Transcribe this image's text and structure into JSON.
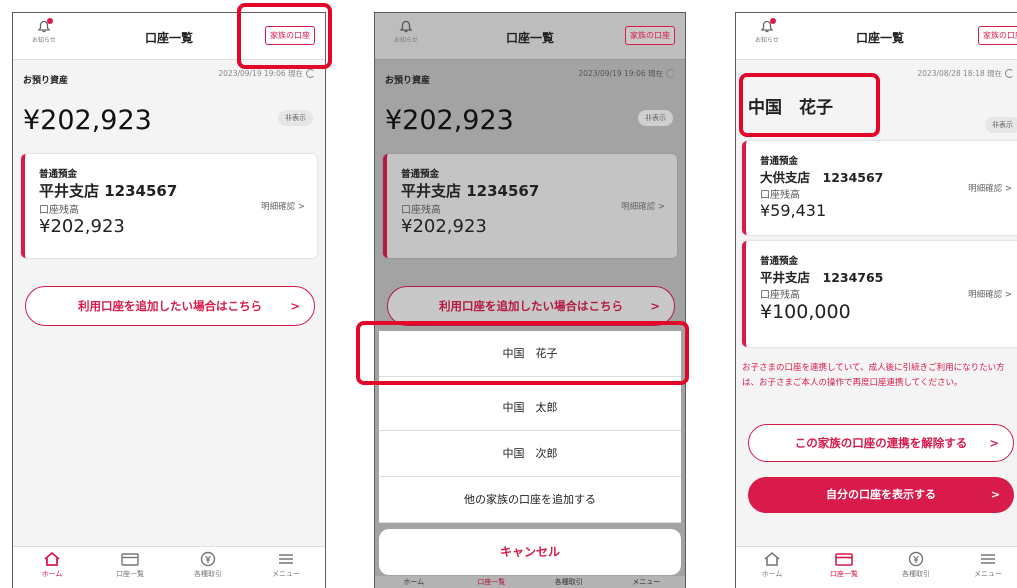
{
  "common": {
    "notification_label": "お知らせ",
    "title": "口座一覧",
    "family_button": "家族の口座",
    "details_link": "明細確認 >",
    "balance_label": "口座残高",
    "account_type": "普通預金",
    "hide_button": "非表示",
    "assets_label": "お預り資産"
  },
  "screen1": {
    "as_of": "2023/09/19 19:06 現在",
    "total": "¥202,923",
    "account": {
      "branch": "平井支店 1234567",
      "balance": "¥202,923"
    },
    "add_account_button": "利用口座を追加したい場合はこちら",
    "tabs": [
      {
        "label": "ホーム",
        "icon": "home-icon",
        "active": true
      },
      {
        "label": "口座一覧",
        "icon": "card-icon",
        "active": false
      },
      {
        "label": "各種取引",
        "icon": "yen-icon",
        "active": false
      },
      {
        "label": "メニュー",
        "icon": "menu-icon",
        "active": false
      }
    ]
  },
  "screen2": {
    "as_of": "2023/09/19 19:06 現在",
    "total": "¥202,923",
    "account": {
      "branch": "平井支店 1234567",
      "balance": "¥202,923"
    },
    "add_account_button": "利用口座を追加したい場合はこちら",
    "sheet_items": [
      "中国　花子",
      "中国　太郎",
      "中国　次郎",
      "他の家族の口座を追加する"
    ],
    "cancel": "キャンセル",
    "tabs": [
      "ホーム",
      "口座一覧",
      "各種取引",
      "メニュー"
    ]
  },
  "screen3": {
    "as_of": "2023/08/28 18:18 現在",
    "owner": "中国　花子",
    "accounts": [
      {
        "branch": "大供支店　1234567",
        "balance": "¥59,431"
      },
      {
        "branch": "平井支店　1234765",
        "balance": "¥100,000"
      }
    ],
    "notice": "お子さまの口座を連携していて、成人後に引続きご利用になりたい方は、お子さまご本人の操作で再度口座連携してください。",
    "unlink_button": "この家族の口座の連携を解除する",
    "own_accounts_button": "自分の口座を表示する",
    "tabs": [
      {
        "label": "ホーム",
        "icon": "home-icon",
        "active": false
      },
      {
        "label": "口座一覧",
        "icon": "card-icon",
        "active": true
      },
      {
        "label": "各種取引",
        "icon": "yen-icon",
        "active": false
      },
      {
        "label": "メニュー",
        "icon": "menu-icon",
        "active": false
      }
    ]
  },
  "colors": {
    "accent": "#d81b4a",
    "highlight": "#e3062a"
  }
}
